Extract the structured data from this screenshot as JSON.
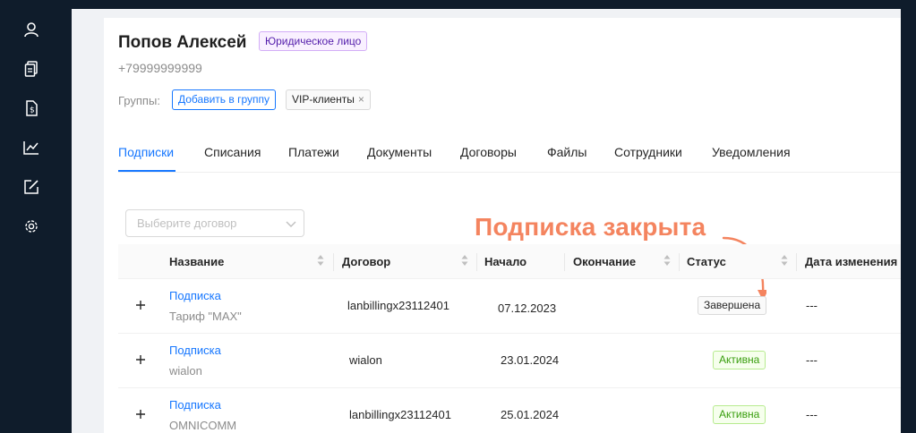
{
  "sidebar": {
    "icons": [
      "user-icon",
      "documents-icon",
      "bill-icon",
      "chart-icon",
      "edit-icon",
      "gear-icon"
    ]
  },
  "client": {
    "name": "Попов Алексей",
    "entity_type": "Юридическое лицо",
    "phone": "+79999999999"
  },
  "groups": {
    "label": "Группы:",
    "add_button": "Добавить в группу",
    "tags": [
      "VIP-клиенты"
    ]
  },
  "tabs": [
    {
      "label": "Подписки",
      "active": true
    },
    {
      "label": "Списания",
      "active": false
    },
    {
      "label": "Платежи",
      "active": false
    },
    {
      "label": "Документы",
      "active": false
    },
    {
      "label": "Договоры",
      "active": false
    },
    {
      "label": "Файлы",
      "active": false
    },
    {
      "label": "Сотрудники",
      "active": false
    },
    {
      "label": "Уведомления",
      "active": false
    }
  ],
  "filter": {
    "contract_placeholder": "Выберите договор"
  },
  "annotation": "Подписка закрыта",
  "table": {
    "columns": [
      "Название",
      "Договор",
      "Начало",
      "Окончание",
      "Статус",
      "Дата изменения"
    ],
    "rows": [
      {
        "name": "Подписка",
        "tariff": "Тариф \"MAX\"",
        "contract": "lanbillingx23112401",
        "start": "07.12.2023",
        "end": "",
        "status": "Завершена",
        "status_kind": "done",
        "changed": "---"
      },
      {
        "name": "Подписка",
        "tariff": "wialon",
        "contract": "wialon",
        "start": "23.01.2024",
        "end": "",
        "status": "Активна",
        "status_kind": "active",
        "changed": "---"
      },
      {
        "name": "Подписка",
        "tariff": "OMNICOMM",
        "contract": "lanbillingx23112401",
        "start": "25.01.2024",
        "end": "",
        "status": "Активна",
        "status_kind": "active",
        "changed": "---"
      }
    ]
  },
  "colors": {
    "primary": "#1677ff",
    "sidebar": "#0f1c2b",
    "annotation": "#f4845f",
    "status_active": "#389e0d"
  }
}
